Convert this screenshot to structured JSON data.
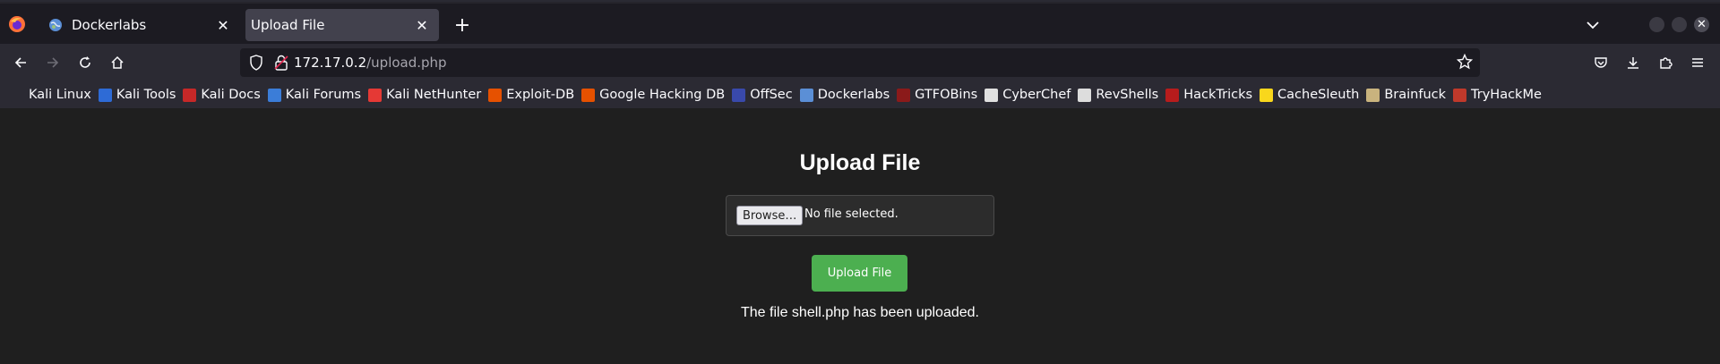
{
  "browser": {
    "tabs": [
      {
        "title": "Dockerlabs",
        "icon": "globe-icon",
        "active": false
      },
      {
        "title": "Upload File",
        "icon": "",
        "active": true
      }
    ],
    "new_tab": "+",
    "url_host": "172.17.0.2",
    "url_path": "/upload.php"
  },
  "bookmarks": [
    {
      "label": "Kali Linux",
      "icon": "kali-dragon-icon",
      "color": "#2b2a33"
    },
    {
      "label": "Kali Tools",
      "icon": "kali-tools-icon",
      "color": "#2e6bd6"
    },
    {
      "label": "Kali Docs",
      "icon": "kali-docs-icon",
      "color": "#c62828"
    },
    {
      "label": "Kali Forums",
      "icon": "kali-forums-icon",
      "color": "#3b7dd8"
    },
    {
      "label": "Kali NetHunter",
      "icon": "nethunter-icon",
      "color": "#e53935"
    },
    {
      "label": "Exploit-DB",
      "icon": "exploitdb-icon",
      "color": "#e65100"
    },
    {
      "label": "Google Hacking DB",
      "icon": "ghdb-icon",
      "color": "#e65100"
    },
    {
      "label": "OffSec",
      "icon": "offsec-icon",
      "color": "#3949ab"
    },
    {
      "label": "Dockerlabs",
      "icon": "globe-icon",
      "color": "#5b8fd6"
    },
    {
      "label": "GTFOBins",
      "icon": "gtfobins-icon",
      "color": "#8b1a1a"
    },
    {
      "label": "CyberChef",
      "icon": "cyberchef-icon",
      "color": "#e0e0e0"
    },
    {
      "label": "RevShells",
      "icon": "skull-icon",
      "color": "#dddddd"
    },
    {
      "label": "HackTricks",
      "icon": "hacktricks-icon",
      "color": "#b71c1c"
    },
    {
      "label": "CacheSleuth",
      "icon": "cachesleuth-icon",
      "color": "#f9d71c"
    },
    {
      "label": "Brainfuck",
      "icon": "brainfuck-icon",
      "color": "#c9b37e"
    },
    {
      "label": "TryHackMe",
      "icon": "tryhackme-icon",
      "color": "#c0392b"
    }
  ],
  "page": {
    "heading": "Upload File",
    "browse_label": "Browse…",
    "file_status": "No file selected.",
    "upload_button": "Upload File",
    "message": "The file shell.php has been uploaded."
  }
}
